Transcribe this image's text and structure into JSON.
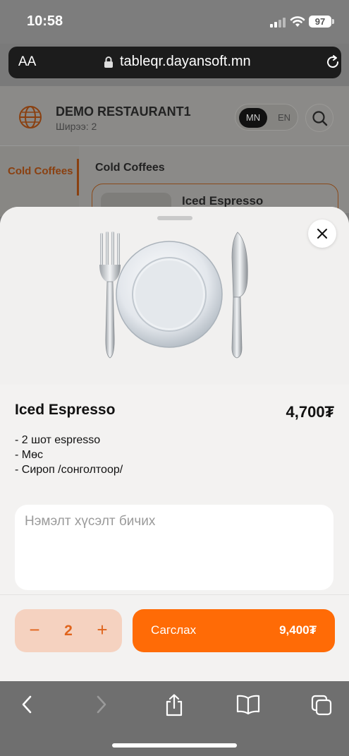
{
  "status": {
    "time": "10:58",
    "battery": "97"
  },
  "browser": {
    "aa_label": "AA",
    "url": "tableqr.dayansoft.mn"
  },
  "restaurant": {
    "name": "DEMO RESTAURANT1",
    "table": "Ширээ: 2"
  },
  "language": {
    "mn": "MN",
    "en": "EN",
    "selected": "MN"
  },
  "sidebar": {
    "active_category": "Cold Coffees"
  },
  "menu": {
    "section_title": "Cold Coffees",
    "first_item": "Iced Espresso"
  },
  "product": {
    "name": "Iced Espresso",
    "price": "4,700₮",
    "description": [
      "- 2 шот espresso",
      "- Мөс",
      "- Сироп /сонголтоор/"
    ]
  },
  "note": {
    "placeholder": "Нэмэлт хүсэлт бичих"
  },
  "cart": {
    "minus": "−",
    "quantity": "2",
    "plus": "+",
    "order_label": "Сагслах",
    "total": "9,400₮"
  },
  "colors": {
    "accent": "#ff6b06",
    "stepper_bg": "#f5d2c0"
  },
  "icons": {
    "close": "close-icon",
    "dish": "fork-plate-knife-icon"
  }
}
